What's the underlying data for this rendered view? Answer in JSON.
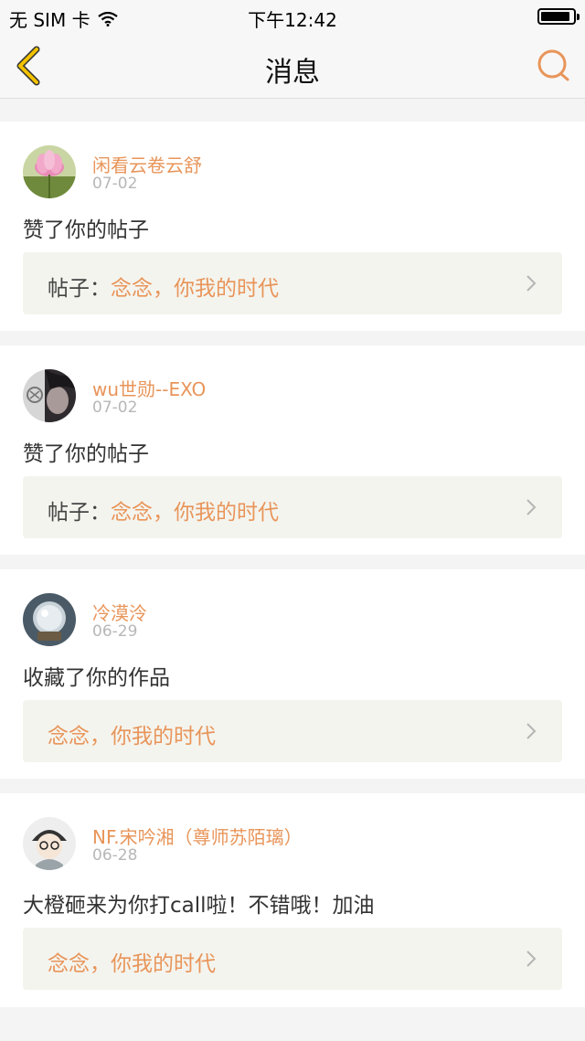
{
  "status": {
    "carrier": "无 SIM 卡",
    "time": "下午12:42",
    "battery_level": 0.9
  },
  "nav": {
    "title": "消息",
    "back_icon": "chevron-left-icon",
    "search_icon": "search-icon"
  },
  "colors": {
    "accent": "#e8955a",
    "back_icon": "#f2c200",
    "ref_bg": "#f4f4ee"
  },
  "messages": [
    {
      "user": "闲看云卷云舒",
      "date": "07-02",
      "action": "赞了你的帖子",
      "ref_prefix": "帖子：",
      "ref_title": "念念，你我的时代"
    },
    {
      "user": "wu世勋--EXO",
      "date": "07-02",
      "action": "赞了你的帖子",
      "ref_prefix": "帖子：",
      "ref_title": "念念，你我的时代"
    },
    {
      "user": "冷漠泠",
      "date": "06-29",
      "action": "收藏了你的作品",
      "ref_prefix": "",
      "ref_title": "念念，你我的时代"
    },
    {
      "user": "NF.宋吟湘（尊师苏陌璃）",
      "date": "06-28",
      "action": "大橙砸来为你打call啦！不错哦！加油",
      "ref_prefix": "",
      "ref_title": "念念，你我的时代"
    }
  ]
}
